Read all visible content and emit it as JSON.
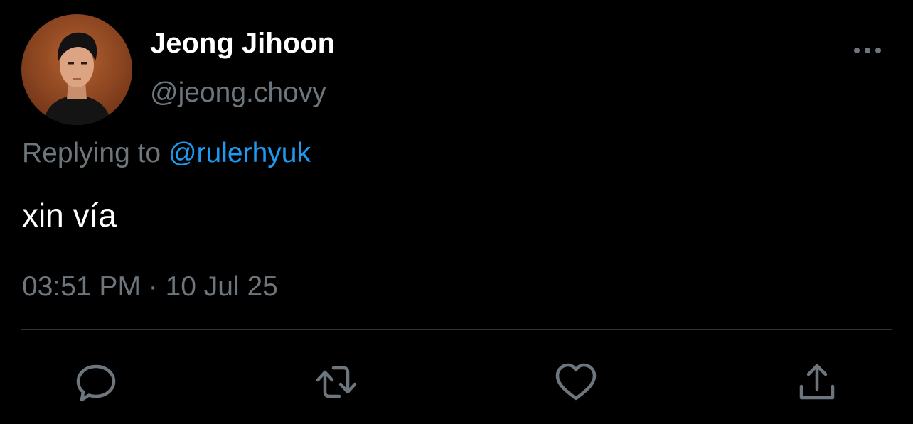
{
  "author": {
    "display_name": "Jeong Jihoon",
    "handle": "@jeong.chovy"
  },
  "reply": {
    "prefix": "Replying to",
    "mention": "@rulerhyuk"
  },
  "tweet": {
    "text": "xin vía",
    "timestamp": "03:51 PM · 10 Jul 25"
  },
  "actions": {
    "reply_icon": "speech-bubble-icon",
    "retweet_icon": "retweet-icon",
    "like_icon": "heart-icon",
    "share_icon": "share-upload-icon",
    "more_icon": "more-horizontal-icon"
  },
  "colors": {
    "background": "#000000",
    "text_primary": "#ffffff",
    "text_secondary": "#6e767d",
    "link": "#1d9bf0",
    "divider": "#2f3336"
  }
}
